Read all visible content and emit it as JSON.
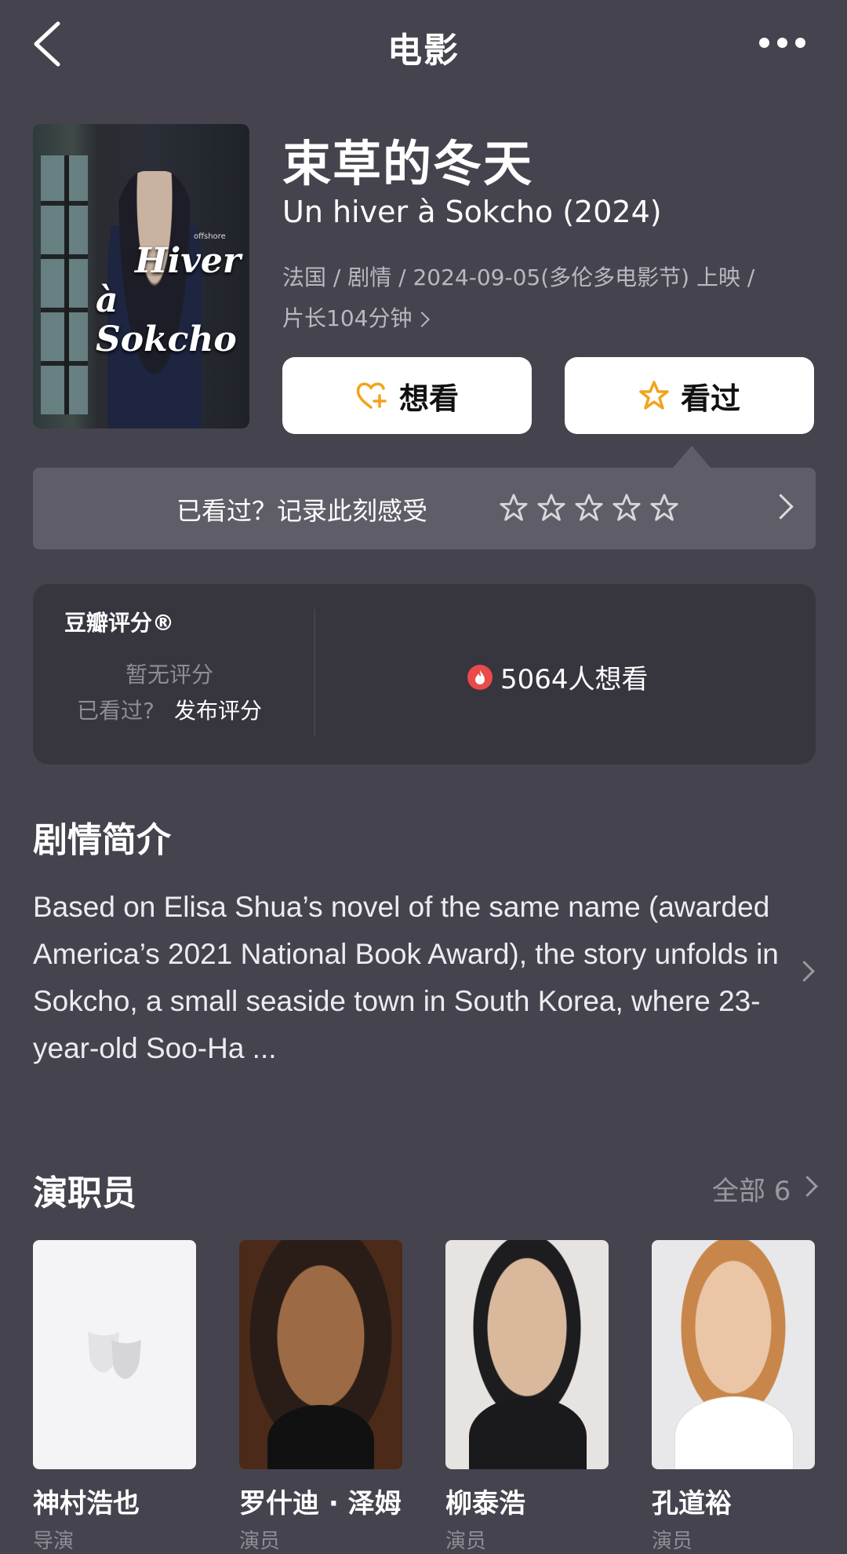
{
  "nav": {
    "title": "电影",
    "back_icon": "chevron-left-icon",
    "more_icon": "more-dots-icon"
  },
  "poster": {
    "title_line1": "Hiver",
    "title_line2": "à Sokcho",
    "label": "offshore"
  },
  "movie": {
    "title": "束草的冬天",
    "subtitle": "Un hiver à Sokcho (2024)",
    "meta_line1": "法国 / 剧情 / 2024-09-05(多伦多电影节) 上映 /",
    "meta_line2": "片长104分钟"
  },
  "actions": {
    "want_label": "想看",
    "seen_label": "看过",
    "accent": "#f2a31b"
  },
  "record": {
    "prompt": "已看过？记录此刻感受",
    "stars": 5
  },
  "rating": {
    "label": "豆瓣评分®",
    "no_rating": "暂无评分",
    "seen_question": "已看过?",
    "post_rating": "发布评分",
    "want_count": "5064人想看"
  },
  "synopsis": {
    "title": "剧情简介",
    "text": "Based on Elisa Shua’s novel of the same name (awarded America’s 2021 National Book Award), the story unfolds in Sokcho, a small seaside town in South Korea, where 23-year-old Soo-Ha ..."
  },
  "cast": {
    "title": "演职员",
    "all_label": "全部 6",
    "members": [
      {
        "name": "神村浩也",
        "role": "导演"
      },
      {
        "name": "罗什迪 · 泽姆",
        "role": "演员"
      },
      {
        "name": "柳泰浩",
        "role": "演员"
      },
      {
        "name": "孔道裕",
        "role": "演员"
      }
    ]
  }
}
